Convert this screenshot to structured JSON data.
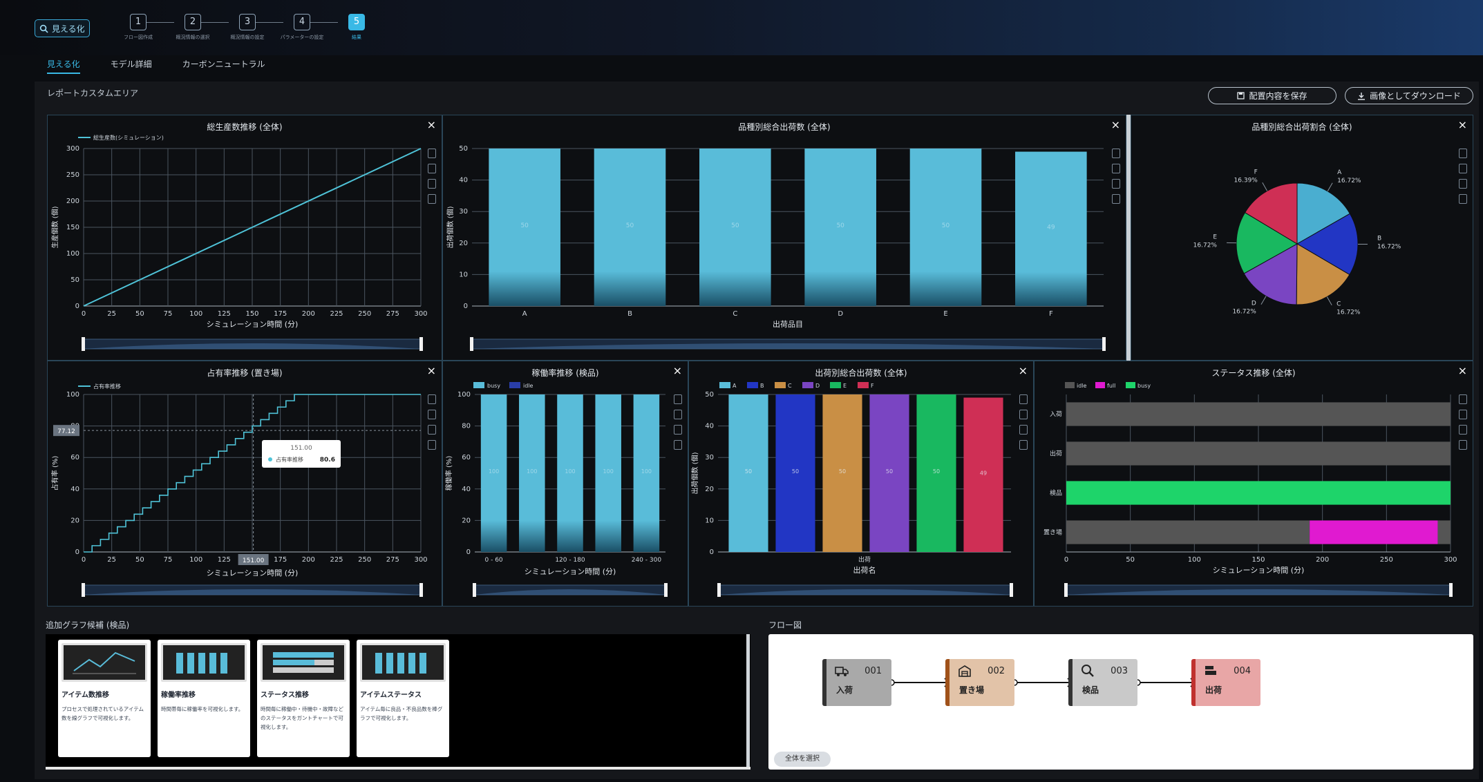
{
  "header": {
    "logo_label": "見える化",
    "steps": [
      {
        "num": "1",
        "label": "フロー図作成"
      },
      {
        "num": "2",
        "label": "概況情報の選択"
      },
      {
        "num": "3",
        "label": "概況情報の設定"
      },
      {
        "num": "4",
        "label": "パラメーターの設定"
      },
      {
        "num": "5",
        "label": "結果"
      }
    ],
    "active_step": 5
  },
  "tabs": [
    "見える化",
    "モデル詳細",
    "カーボンニュートラル"
  ],
  "report": {
    "title": "レポートカスタムエリア",
    "save_label": "配置内容を保存",
    "download_label": "画像としてダウンロード"
  },
  "charts": {
    "production": {
      "title": "総生産数推移 (全体)",
      "legend": "総生産数(シミュレーション)",
      "xlabel": "シミュレーション時間 (分)",
      "ylabel": "生産個数 (個)",
      "color": "#4fc3d8",
      "chart_data": {
        "type": "line",
        "x": [
          0,
          300
        ],
        "y": [
          0,
          300
        ],
        "xlim": [
          0,
          300
        ],
        "ylim": [
          0,
          300
        ],
        "xticks": [
          0,
          25,
          50,
          75,
          100,
          125,
          150,
          175,
          200,
          225,
          250,
          275,
          300
        ],
        "yticks": [
          0,
          50,
          100,
          150,
          200,
          250,
          300
        ],
        "grid": true
      }
    },
    "shipment_by_item": {
      "title": "品種別総合出荷数 (全体)",
      "xlabel": "出荷品目",
      "ylabel": "出荷個数 (個)",
      "color": "#59bcd9",
      "chart_data": {
        "type": "bar",
        "categories": [
          "A",
          "B",
          "C",
          "D",
          "E",
          "F"
        ],
        "values": [
          50,
          50,
          50,
          50,
          50,
          49
        ],
        "ylim": [
          0,
          50
        ],
        "yticks": [
          0,
          10,
          20,
          30,
          40,
          50
        ],
        "data_labels": [
          "50",
          "50",
          "50",
          "50",
          "50",
          "49"
        ]
      }
    },
    "shipment_ratio": {
      "title": "品種別総合出荷割合 (全体)",
      "chart_data": {
        "type": "pie",
        "slices": [
          {
            "label": "A",
            "pct": "16.72%",
            "value": 16.72,
            "color": "#4aaed0"
          },
          {
            "label": "B",
            "pct": "16.72%",
            "value": 16.72,
            "color": "#2236c4"
          },
          {
            "label": "C",
            "pct": "16.72%",
            "value": 16.72,
            "color": "#c98f45"
          },
          {
            "label": "D",
            "pct": "16.72%",
            "value": 16.72,
            "color": "#7a45c2"
          },
          {
            "label": "E",
            "pct": "16.72%",
            "value": 16.72,
            "color": "#19b860"
          },
          {
            "label": "F",
            "pct": "16.39%",
            "value": 16.39,
            "color": "#cf2f55"
          }
        ]
      }
    },
    "occupancy": {
      "title": "占有率推移 (置き場)",
      "legend": "占有率推移",
      "xlabel": "シミュレーション時間 (分)",
      "ylabel": "占有率 (%)",
      "y_pointer": "77.12",
      "x_pointer": "151.00",
      "tooltip_title": "151.00",
      "tooltip_series": "占有率推移",
      "tooltip_value": "80.6",
      "color": "#4fc3d8",
      "chart_data": {
        "type": "line",
        "x": [
          0,
          7.5,
          15,
          22.5,
          30,
          37.5,
          45,
          52.5,
          60,
          67.5,
          75,
          82.5,
          90,
          97.5,
          105,
          112.5,
          120,
          127.5,
          135,
          142.5,
          150,
          157.5,
          165,
          172.5,
          180,
          187.5,
          300
        ],
        "y": [
          0,
          4,
          8,
          12,
          16,
          20,
          24,
          28,
          32,
          36,
          40,
          44,
          48,
          52,
          56,
          60,
          64,
          68,
          72,
          76,
          80,
          84,
          88,
          92,
          96,
          100,
          100
        ],
        "xlim": [
          0,
          300
        ],
        "ylim": [
          0,
          100
        ],
        "xticks": [
          "0",
          "25",
          "50",
          "75",
          "100",
          "125",
          "",
          "175",
          "200",
          "225",
          "250",
          "275",
          "300"
        ],
        "yticks": [
          0,
          20,
          40,
          60,
          80,
          100
        ],
        "step": true,
        "grid": true
      }
    },
    "utilization": {
      "title": "稼働率推移 (検品)",
      "legend": [
        "busy",
        "idle"
      ],
      "xlabel": "シミュレーション時間 (分)",
      "ylabel": "稼働率 (%)",
      "colors": {
        "busy": "#59bcd9",
        "idle": "#2a3ea8"
      },
      "chart_data": {
        "type": "bar",
        "categories": [
          "0 - 60",
          "",
          "120 - 180",
          "",
          "240 - 300"
        ],
        "series": [
          {
            "name": "busy",
            "values": [
              100,
              100,
              100,
              100,
              100
            ]
          },
          {
            "name": "idle",
            "values": [
              0,
              0,
              0,
              0,
              0
            ]
          }
        ],
        "data_labels": [
          "100",
          "100",
          "100",
          "100",
          "100"
        ],
        "ylim": [
          0,
          100
        ],
        "yticks": [
          0,
          20,
          40,
          60,
          80,
          100
        ]
      }
    },
    "shipment_by_dest": {
      "title": "出荷別総合出荷数 (全体)",
      "legend": [
        "A",
        "B",
        "C",
        "D",
        "E",
        "F"
      ],
      "category": "出荷",
      "xlabel": "出荷名",
      "ylabel": "出荷個数 (個)",
      "colors": [
        "#59bcd9",
        "#2236c4",
        "#c98f45",
        "#7a45c2",
        "#19b860",
        "#cf2f55"
      ],
      "chart_data": {
        "type": "bar",
        "categories": [
          "出荷"
        ],
        "series": [
          {
            "name": "A",
            "values": [
              50
            ]
          },
          {
            "name": "B",
            "values": [
              50
            ]
          },
          {
            "name": "C",
            "values": [
              50
            ]
          },
          {
            "name": "D",
            "values": [
              50
            ]
          },
          {
            "name": "E",
            "values": [
              50
            ]
          },
          {
            "name": "F",
            "values": [
              49
            ]
          }
        ],
        "data_labels": [
          "50",
          "50",
          "50",
          "50",
          "50",
          "49"
        ],
        "ylim": [
          0,
          50
        ],
        "yticks": [
          0,
          10,
          20,
          30,
          40,
          50
        ]
      }
    },
    "status": {
      "title": "ステータス推移 (全体)",
      "legend": [
        "idle",
        "full",
        "busy"
      ],
      "xlabel": "シミュレーション時間 (分)",
      "colors": {
        "idle": "#555555",
        "full": "#e01ad0",
        "busy": "#1ed46a"
      },
      "chart_data": {
        "type": "bar",
        "orientation": "horizontal-timeline",
        "rows": [
          "入荷",
          "出荷",
          "検品",
          "置き場"
        ],
        "segments": [
          {
            "row": "入荷",
            "state": "idle",
            "start": 0,
            "end": 300
          },
          {
            "row": "出荷",
            "state": "idle",
            "start": 0,
            "end": 300
          },
          {
            "row": "検品",
            "state": "busy",
            "start": 0,
            "end": 300
          },
          {
            "row": "置き場",
            "state": "idle",
            "start": 0,
            "end": 190
          },
          {
            "row": "置き場",
            "state": "full",
            "start": 190,
            "end": 290
          },
          {
            "row": "置き場",
            "state": "idle",
            "start": 290,
            "end": 300
          }
        ],
        "xlim": [
          0,
          300
        ],
        "xticks": [
          0,
          50,
          100,
          150,
          200,
          250,
          300
        ]
      }
    }
  },
  "add_graph": {
    "title": "追加グラフ候補 (検品)",
    "cards": [
      {
        "name": "アイテム数推移",
        "desc": "プロセスで処理されているアイテム数を線グラフで可視化します。",
        "icon": "line-chart-icon"
      },
      {
        "name": "稼働率推移",
        "desc": "時間帯毎に稼働率を可視化します。",
        "icon": "bar-chart-icon"
      },
      {
        "name": "ステータス推移",
        "desc": "時間毎に稼働中・待機中・故障などのステータスをガントチャートで可視化します。",
        "icon": "gantt-chart-icon"
      },
      {
        "name": "アイテムステータス",
        "desc": "アイテム毎に良品・不良品数を棒グラフで可視化します。",
        "icon": "stacked-bar-icon"
      }
    ]
  },
  "flow": {
    "title": "フロー図",
    "select_all": "全体を選択",
    "nodes": [
      {
        "id": "001",
        "name": "入荷",
        "bg": "#a9a9a9",
        "border": "#333333",
        "icon": "truck-icon"
      },
      {
        "id": "002",
        "name": "置き場",
        "bg": "#e2c3a8",
        "border": "#a0521a",
        "icon": "warehouse-icon"
      },
      {
        "id": "003",
        "name": "検品",
        "bg": "#c9c9c9",
        "border": "#333333",
        "icon": "magnifier-icon"
      },
      {
        "id": "004",
        "name": "出荷",
        "bg": "#e8a6a6",
        "border": "#c0312e",
        "icon": "shipping-icon"
      }
    ]
  }
}
